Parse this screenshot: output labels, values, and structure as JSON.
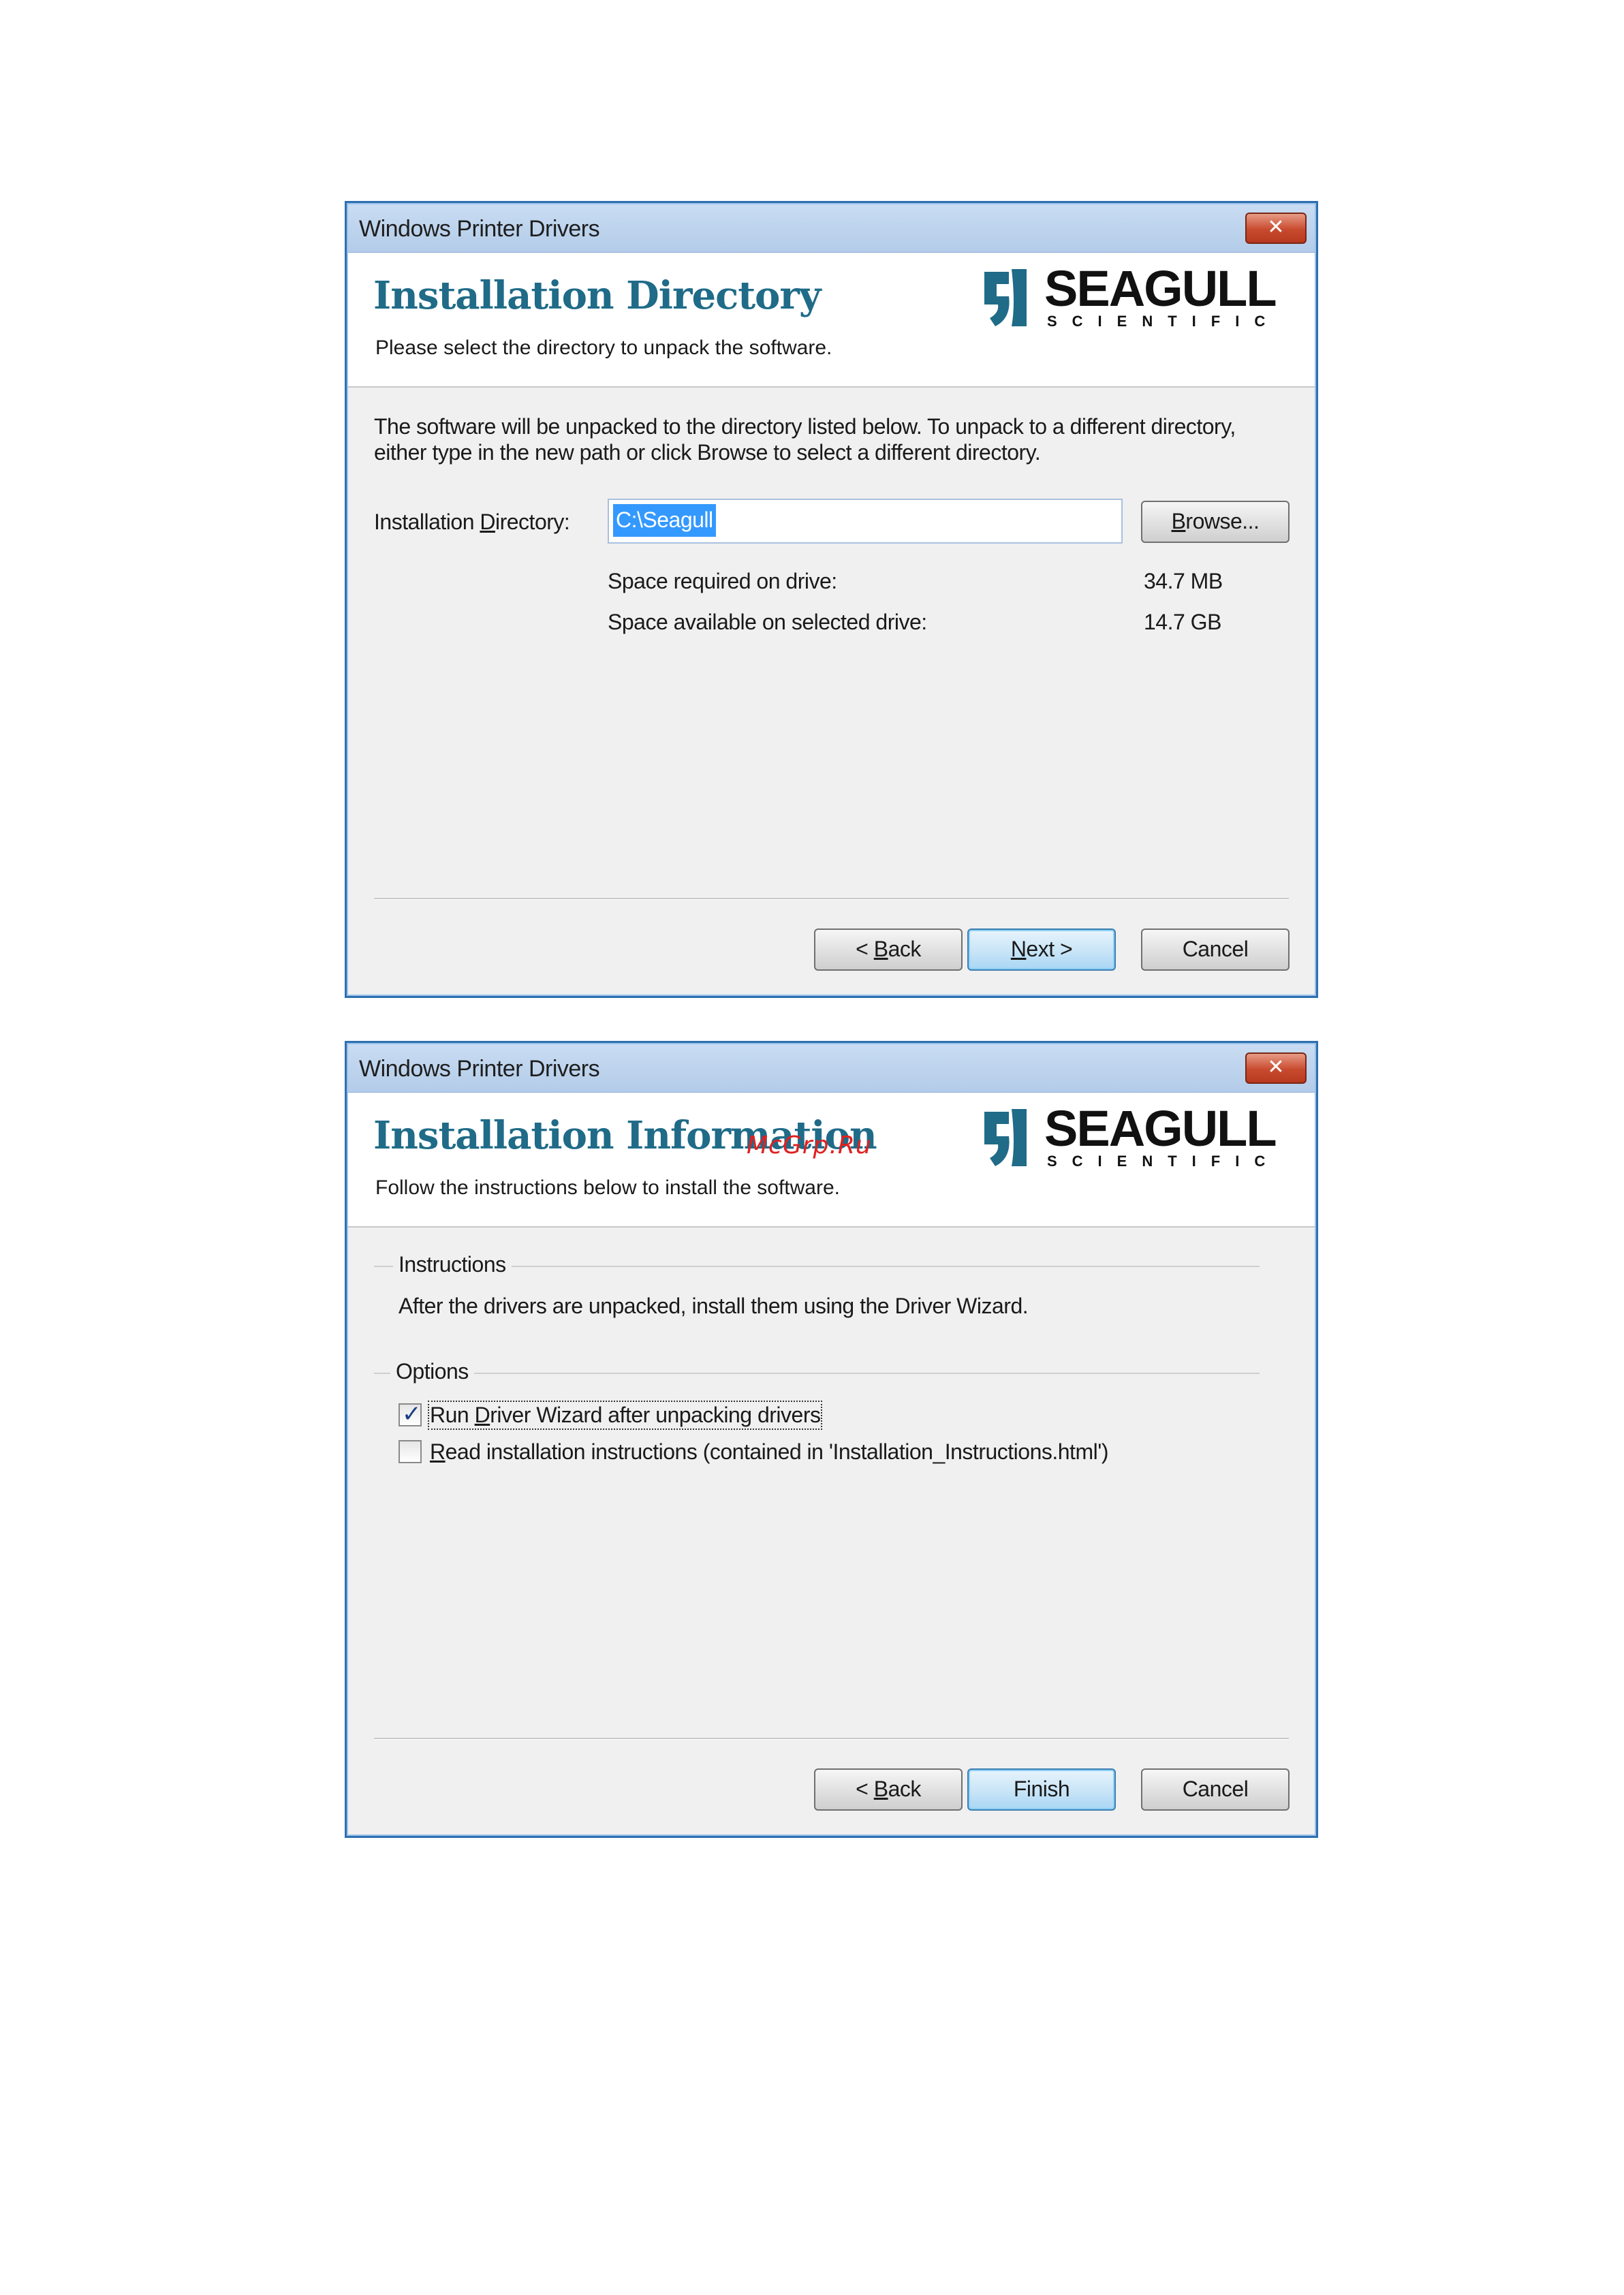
{
  "dialog1": {
    "window_title": "Windows Printer Drivers",
    "close_glyph": "✕",
    "header_title": "Installation Directory",
    "header_subtitle": "Please select the directory to unpack the software.",
    "logo": {
      "name": "SEAGULL",
      "sub": "SCIENTIFIC"
    },
    "description_line1": "The software will be unpacked to the directory listed below.  To unpack to a different directory,",
    "description_line2": "either type in the new path or click Browse to select a different directory.",
    "dir_label_before": "Installation ",
    "dir_label_underlined": "D",
    "dir_label_after": "irectory:",
    "dir_value": "C:\\Seagull",
    "browse_underlined": "B",
    "browse_after": "rowse...",
    "space_required_label": "Space required on drive:",
    "space_required_value": "34.7 MB",
    "space_available_label": "Space available on selected drive:",
    "space_available_value": "14.7 GB",
    "back_before": "< ",
    "back_underlined": "B",
    "back_after": "ack",
    "next_underlined": "N",
    "next_after": "ext >",
    "cancel_label": "Cancel"
  },
  "dialog2": {
    "window_title": "Windows Printer Drivers",
    "close_glyph": "✕",
    "header_title": "Installation Information",
    "header_subtitle": "Follow the instructions below to install the software.",
    "logo": {
      "name": "SEAGULL",
      "sub": "SCIENTIFIC"
    },
    "instructions_group": "Instructions",
    "instructions_text": "After the drivers are unpacked, install them using the Driver Wizard.",
    "options_group": "Options",
    "option1_before": "Run ",
    "option1_underlined": "D",
    "option1_after": "river Wizard after unpacking drivers",
    "option1_checked": true,
    "option2_underlined": "R",
    "option2_after": "ead installation instructions (contained in 'Installation_Instructions.html')",
    "option2_checked": false,
    "check_glyph": "✓",
    "back_before": "< ",
    "back_underlined": "B",
    "back_after": "ack",
    "finish_label": "Finish",
    "cancel_label": "Cancel"
  },
  "watermark": "McGrp.Ru",
  "colors": {
    "header_title": "#1f6b88",
    "titlebar": "#c9dcf2",
    "selection": "#3399ff",
    "watermark": "#e02020"
  }
}
